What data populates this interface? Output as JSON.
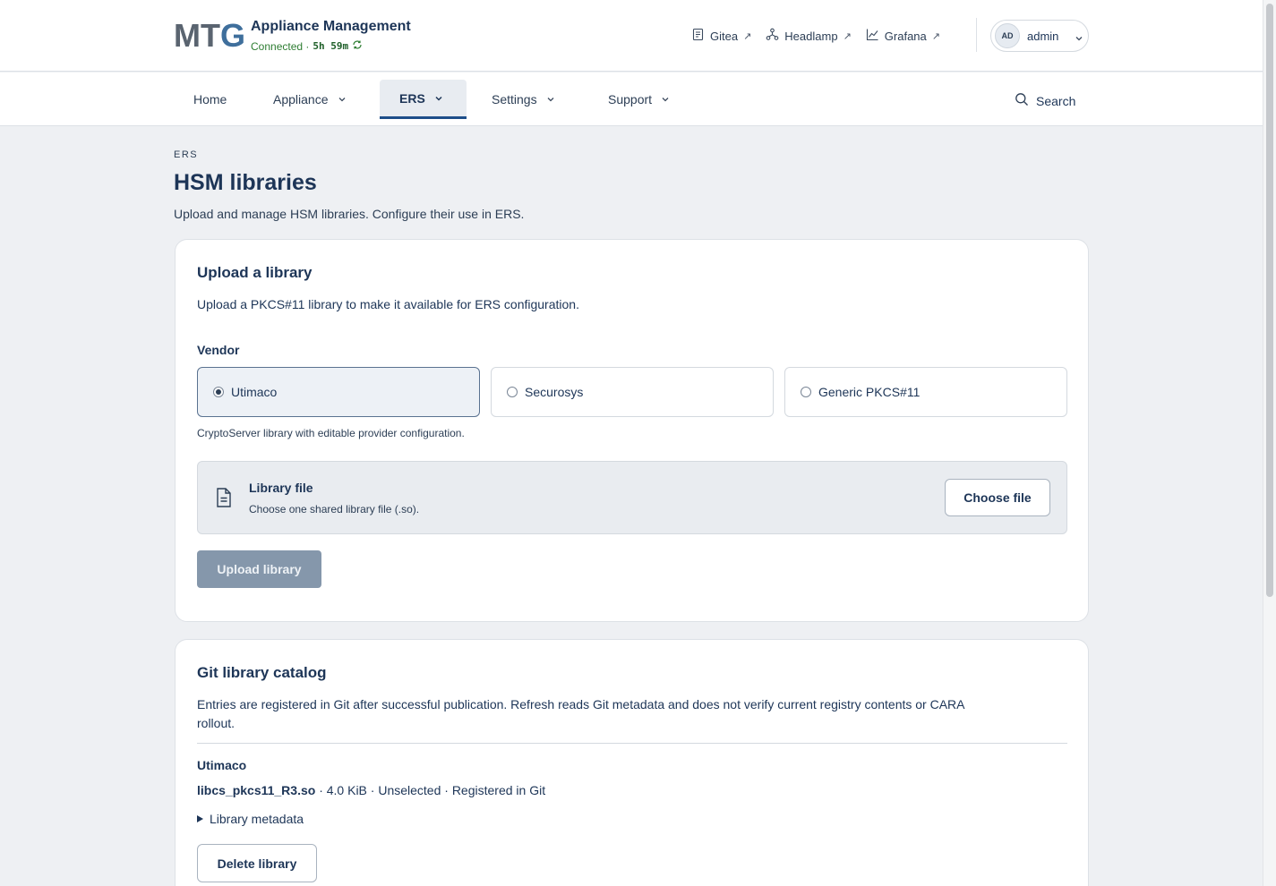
{
  "header": {
    "logo_text": "MTG",
    "app_title": "Appliance Management",
    "connection_label": "Connected ·",
    "uptime": "5h 59m",
    "links": [
      {
        "label": "Gitea",
        "icon": "document-icon"
      },
      {
        "label": "Headlamp",
        "icon": "nodes-icon"
      },
      {
        "label": "Grafana",
        "icon": "chart-icon"
      }
    ],
    "external_arrow": "↗",
    "user": {
      "initials": "AD",
      "name": "admin"
    }
  },
  "nav": {
    "items": [
      {
        "label": "Home",
        "has_menu": false
      },
      {
        "label": "Appliance",
        "has_menu": true
      },
      {
        "label": "ERS",
        "has_menu": true,
        "active": true
      },
      {
        "label": "Settings",
        "has_menu": true
      },
      {
        "label": "Support",
        "has_menu": true
      }
    ],
    "search_label": "Search"
  },
  "page": {
    "breadcrumb": "ERS",
    "title": "HSM libraries",
    "subtitle": "Upload and manage HSM libraries. Configure their use in ERS."
  },
  "upload_card": {
    "title": "Upload a library",
    "description": "Upload a PKCS#11 library to make it available for ERS configuration.",
    "vendor_label": "Vendor",
    "vendors": [
      {
        "label": "Utimaco",
        "selected": true
      },
      {
        "label": "Securosys",
        "selected": false
      },
      {
        "label": "Generic PKCS#11",
        "selected": false
      }
    ],
    "vendor_help": "CryptoServer library with editable provider configuration.",
    "file_title": "Library file",
    "file_hint": "Choose one shared library file (.so).",
    "choose_button": "Choose file",
    "upload_button": "Upload library"
  },
  "catalog_card": {
    "title": "Git library catalog",
    "description_line1": "Entries are registered in Git after successful publication. Refresh reads Git metadata and does not verify current registry contents or CARA",
    "description_line2": "rollout.",
    "group": "Utimaco",
    "library": {
      "filename": "libcs_pkcs11_R3.so",
      "details": " · 4.0 KiB · Unselected · Registered in Git"
    },
    "metadata_toggle": "Library metadata",
    "delete_button": "Delete library"
  },
  "colors": {
    "brand_navy": "#1d3557",
    "connected_green": "#2e7d32",
    "disabled_button": "#8597ab",
    "background": "#eef0f3"
  }
}
